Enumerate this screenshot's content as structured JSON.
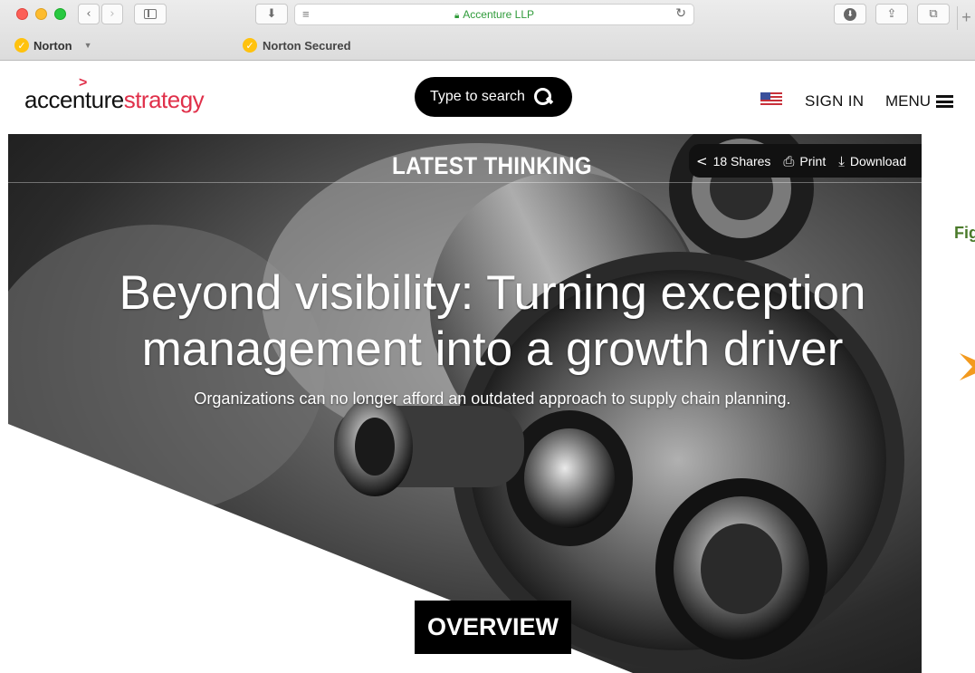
{
  "browser": {
    "url_display": "Accenture LLP",
    "new_tab_symbol": "+"
  },
  "norton": {
    "brand": "Norton",
    "secured": "Norton Secured"
  },
  "site": {
    "brand_part1": "accenture",
    "brand_part2": "strategy",
    "brand_mark": ">",
    "search_label": "Type to search",
    "sign_in": "SIGN IN",
    "menu": "MENU"
  },
  "hero": {
    "section_label": "LATEST THINKING",
    "shares": "18 Shares",
    "print": "Print",
    "download": "Download",
    "headline_line1": "Beyond visibility: Turning exception",
    "headline_line2": "management into a growth driver",
    "subline": "Organizations can no longer afford an outdated approach to supply chain planning.",
    "overview": "OVERVIEW"
  },
  "side_panel": {
    "fig_text": "Fig"
  },
  "colors": {
    "brand_red": "#e0304a",
    "url_green": "#2f9b3a",
    "norton_yellow": "#ffc20e",
    "fig_green": "#4a7a2a",
    "accent_orange": "#f39a1e"
  },
  "icons": {
    "back": "chevron-left-icon",
    "forward": "chevron-right-icon",
    "sidebar": "sidebar-icon",
    "download_mgr": "download-manager-icon",
    "reader": "reader-icon",
    "reload": "reload-icon",
    "downloads": "downloads-icon",
    "share_browser": "share-icon",
    "tabs": "tabs-icon",
    "lock": "lock-icon",
    "search": "search-icon",
    "flag": "us-flag-icon",
    "menu": "hamburger-icon",
    "share": "share-icon",
    "print": "print-icon",
    "download": "download-icon"
  }
}
